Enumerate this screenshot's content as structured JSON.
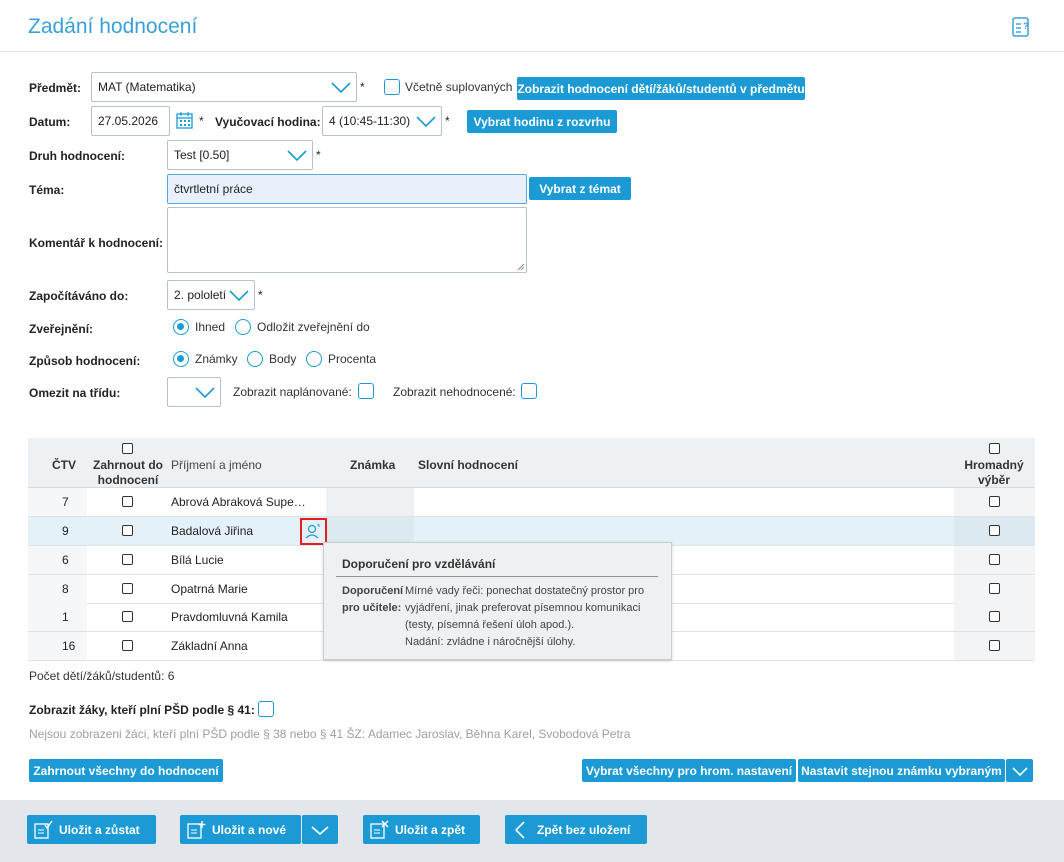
{
  "title": "Zadání hodnocení",
  "form": {
    "subject_label": "Předmět:",
    "subject_value": "MAT (Matematika)",
    "substitute_label": "Včetně suplovaných",
    "show_grades_button": "Zobrazit hodnocení dětí/žáků/studentů v předmětu",
    "date_label": "Datum:",
    "date_value": "27.05.2026",
    "lesson_label": "Vyučovací hodina:",
    "lesson_value": "4 (10:45-11:30)",
    "pick_lesson_button": "Vybrat hodinu z rozvrhu",
    "type_label": "Druh hodnocení:",
    "type_value": "Test [0.50]",
    "topic_label": "Téma:",
    "topic_value": "čtvrtletní práce",
    "pick_topic_button": "Vybrat z témat",
    "comment_label": "Komentář k hodnocení:",
    "counted_label": "Započítáváno do:",
    "counted_value": "2. pololetí",
    "publish_label": "Zveřejnění:",
    "publish_now": "Ihned",
    "publish_later": "Odložit zveřejnění do",
    "method_label": "Způsob hodnocení:",
    "method_marks": "Známky",
    "method_points": "Body",
    "method_percent": "Procenta",
    "limit_label": "Omezit na třídu:",
    "show_planned": "Zobrazit naplánované:",
    "show_ungraded": "Zobrazit nehodnocené:",
    "required_mark": "*"
  },
  "table": {
    "headers": {
      "no": "ČTV",
      "include": "Zahrnout do hodnocení",
      "name": "Příjmení a jméno",
      "grade": "Známka",
      "verbal": "Slovní hodnocení",
      "bulk": "Hromadný výběr"
    },
    "rows": [
      {
        "no": "7",
        "name": "Abrová Abraková Supe…"
      },
      {
        "no": "9",
        "name": "Badalová Jiřina"
      },
      {
        "no": "6",
        "name": "Bílá Lucie"
      },
      {
        "no": "8",
        "name": "Opatrná Marie"
      },
      {
        "no": "1",
        "name": "Pravdomluvná Kamila"
      },
      {
        "no": "16",
        "name": "Základní Anna"
      }
    ],
    "count_text": "Počet dětí/žáků/studentů: 6"
  },
  "tooltip": {
    "title": "Doporučení pro vzdělávání",
    "label": "Doporučení pro učitele:",
    "text1": "Mírné vady řeči: ponechat dostatečný prostor pro vyjádření, jinak preferovat písemnou komunikaci (testy, písemná řešení úloh apod.).",
    "text2": "Nadání: zvládne i náročnější úlohy."
  },
  "psd": {
    "label": "Zobrazit žáky, kteří plní PŠD podle § 41:",
    "note": "Nejsou zobrazeni žáci, kteří plní PŠD podle § 38 nebo § 41 ŠZ: Adamec Jaroslav, Běhna Karel, Svobodová Petra"
  },
  "actions": {
    "include_all": "Zahrnout všechny do hodnocení",
    "select_all_bulk": "Vybrat všechny pro hrom. nastavení",
    "set_same_grade": "Nastavit stejnou známku vybraným"
  },
  "footer": {
    "save_stay": "Uložit a zůstat",
    "save_new": "Uložit a nové",
    "save_back": "Uložit a zpět",
    "back_no_save": "Zpět bez uložení"
  },
  "colors": {
    "accent": "#1b9ad6",
    "title": "#3aa0d8",
    "highlight": "#e02020"
  }
}
